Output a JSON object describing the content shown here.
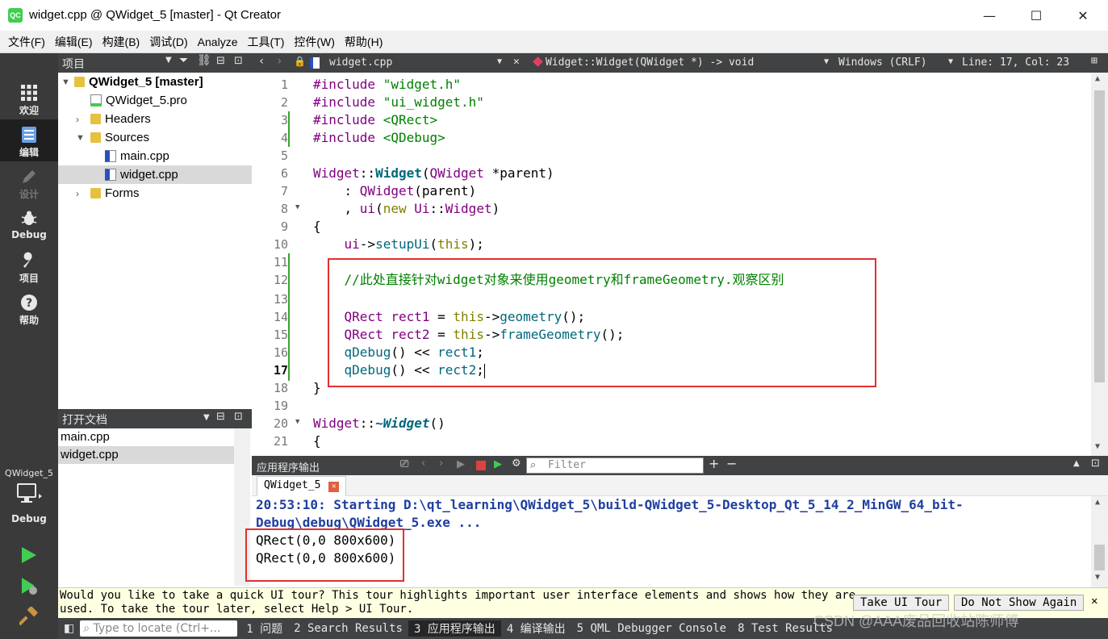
{
  "window": {
    "app_icon": "QC",
    "title": "widget.cpp @ QWidget_5 [master] - Qt Creator",
    "minimize": "—",
    "maximize": "☐",
    "close": "✕"
  },
  "menu": [
    "文件(F)",
    "编辑(E)",
    "构建(B)",
    "调试(D)",
    "Analyze",
    "工具(T)",
    "控件(W)",
    "帮助(H)"
  ],
  "modes": {
    "welcome": "欢迎",
    "edit": "编辑",
    "design": "设计",
    "debug": "Debug",
    "projects": "项目",
    "help": "帮助"
  },
  "kit": {
    "project": "QWidget_5",
    "build": "Debug"
  },
  "projects_panel": {
    "title": "项目",
    "tree": [
      {
        "label": "QWidget_5 [master]",
        "bold": true
      },
      {
        "label": "QWidget_5.pro"
      },
      {
        "label": "Headers"
      },
      {
        "label": "Sources"
      },
      {
        "label": "main.cpp"
      },
      {
        "label": "widget.cpp",
        "selected": true
      },
      {
        "label": "Forms"
      }
    ]
  },
  "open_documents": {
    "title": "打开文档",
    "items": [
      "main.cpp",
      "widget.cpp"
    ]
  },
  "editor_toolbar": {
    "file": "widget.cpp",
    "symbol": "Widget::Widget(QWidget *) -> void",
    "line_endings": "Windows (CRLF)",
    "position": "Line: 17, Col: 23"
  },
  "editor": {
    "line_numbers": [
      "1",
      "2",
      "3",
      "4",
      "5",
      "6",
      "7",
      "8",
      "9",
      "10",
      "11",
      "12",
      "13",
      "14",
      "15",
      "16",
      "17",
      "18",
      "19",
      "20",
      "21"
    ],
    "current_line": "17"
  },
  "output_panel": {
    "title": "应用程序输出",
    "filter_placeholder": "Filter",
    "tab": "QWidget_5",
    "lines": {
      "start1": "20:53:10: Starting D:\\qt_learning\\QWidget_5\\build-QWidget_5-Desktop_Qt_5_14_2_MinGW_64_bit-",
      "start2": "Debug\\debug\\QWidget_5.exe ...",
      "rect1": "QRect(0,0 800x600)",
      "rect2": "QRect(0,0 800x600)"
    }
  },
  "tour": {
    "message1": "Would you like to take a quick UI tour? This tour highlights important user interface elements and shows how they are",
    "message2": "used. To take the tour later, select Help > UI Tour.",
    "take_button": "Take UI Tour",
    "dismiss_button": "Do Not Show Again",
    "close": "✕"
  },
  "statusbar": {
    "locate_placeholder": "Type to locate (Ctrl+...",
    "panes": [
      "1 问题",
      "2 Search Results",
      "3 应用程序输出",
      "4 编译输出",
      "5 QML Debugger Console",
      "8 Test Results"
    ],
    "watermark": "CSDN @AAA废品回收站陈师傅"
  },
  "colors": {
    "dark_panel": "#404244",
    "mode_bar": "#3a3a3a",
    "keyword": "#808000",
    "string": "#008000",
    "type": "#800080",
    "function": "#00677c",
    "highlight_box": "#e03030",
    "output_blue": "#1f3f9f"
  }
}
